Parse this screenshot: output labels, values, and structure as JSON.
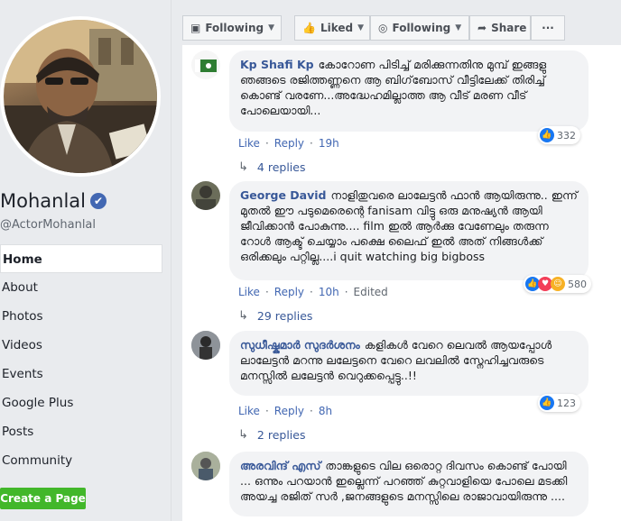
{
  "page": {
    "name": "Mohanlal",
    "handle": "@ActorMohanlal"
  },
  "nav": [
    "Home",
    "About",
    "Photos",
    "Videos",
    "Events",
    "Google Plus",
    "Posts",
    "Community"
  ],
  "create_page": "Create a Page",
  "topbar": {
    "following_left": "Following",
    "liked": "Liked",
    "following": "Following",
    "share": "Share",
    "more": "···"
  },
  "side_more": "···",
  "comments": [
    {
      "author": "Kp Shafi Kp",
      "text": "കോറോണ പിടിച്ച് മരിക്കുന്നതിനു മുമ്പ് ഇങ്ങളു ഞങ്ങടെ രജിത്തണ്ണനെ ആ ബിഗ്‌ബോസ് വീട്ടിലേക്ക് തിരിച്ച് കൊണ്ട് വരണേ...അദ്ധേഹമില്ലാത്ത ആ വീട് മരണ വീട് പോലെയായി...",
      "like": "Like",
      "reply": "Reply",
      "time": "19h",
      "edited": "",
      "reactions": "332",
      "replies": "4 replies"
    },
    {
      "author": "George David",
      "text": "നാളിതുവരെ ലാലേട്ടൻ ഫാൻ ആയിരുന്നു.. ഇന്ന് മുതൽ ഈ പടുമെരെന്റെ fanisam വിട്ടു ഒരു മനുഷ്യൻ ആയി ജീവിക്കാൻ പോകുന്നു.... film ഇൽ ആർക്കു വേണേലും തരുന്ന റോൾ ആക്ട് ചെയ്യാം പക്ഷെ ലൈഫ് ഇൽ അത് നിങ്ങൾക്ക് ഒരിക്കലും പറ്റില്ല....i quit watching big bigboss",
      "like": "Like",
      "reply": "Reply",
      "time": "10h",
      "edited": "Edited",
      "reactions": "580",
      "replies": "29 replies"
    },
    {
      "author": "സുധീഷ്കുമാർ സുദർശനം",
      "text": "കളികൾ വേറെ ലെവൽ ആയപ്പോൾ ലാലേട്ടൻ മറന്നു ലലേട്ടനെ വേറെ ലവലിൽ സ്നേഹിച്ചവരുടെ മനസ്സിൽ ലലേട്ടൻ വെറുക്കപ്പെട്ടു..!!",
      "like": "Like",
      "reply": "Reply",
      "time": "8h",
      "edited": "",
      "reactions": "123",
      "replies": "2 replies"
    },
    {
      "author": "അരവിന്ദ് എസ്",
      "text": "താങ്കളുടെ വില ഒരൊറ്റ ദിവസം കൊണ്ട് പോയി ... ഒന്നും പറയാൻ ഇല്ലെന്ന് പറഞ്ഞ് കുറ്റവാളിയെ പോലെ മടക്കി അയച്ച രജിത് സർ ,ജനങ്ങളുടെ മനസ്സിലെ രാജാവായിരുന്നു ....",
      "like": "",
      "reply": "",
      "time": "",
      "edited": "",
      "reactions": "",
      "replies": ""
    }
  ],
  "colors": {
    "link": "#385898",
    "bg": "#e9ebee",
    "bubble": "#f2f3f5",
    "create_btn": "#42b72a",
    "verified": "#4267b2"
  }
}
